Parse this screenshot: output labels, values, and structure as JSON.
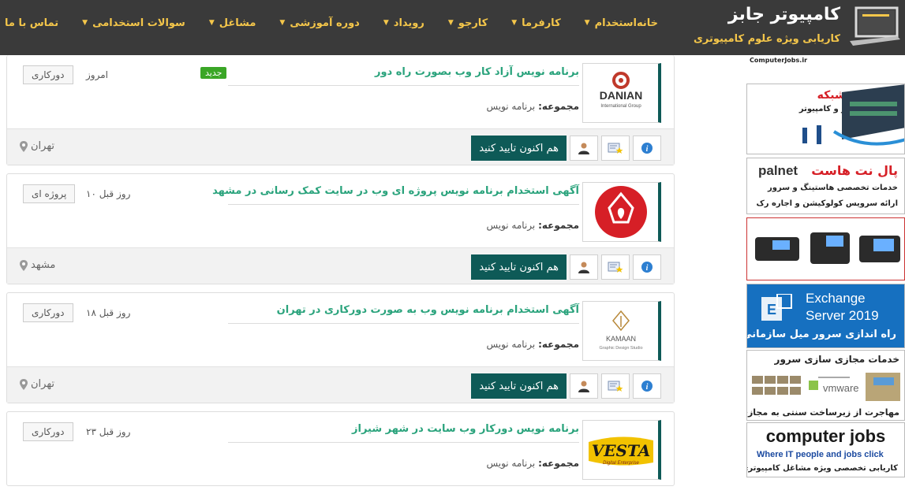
{
  "header": {
    "logo_title": "کامپیوتر جابز",
    "logo_subtitle": "کاریابی ویژه علوم کامپیوتری",
    "nav": [
      {
        "label": "خانه",
        "dropdown": false
      },
      {
        "label": "استخدام",
        "dropdown": true
      },
      {
        "label": "کارفرما",
        "dropdown": true
      },
      {
        "label": "کارجو",
        "dropdown": true
      },
      {
        "label": "رویداد",
        "dropdown": true
      },
      {
        "label": "دوره آموزشی",
        "dropdown": true
      },
      {
        "label": "مشاغل",
        "dropdown": true
      },
      {
        "label": "سوالات استخدامی",
        "dropdown": true
      },
      {
        "label": "تماس با ما",
        "dropdown": true
      }
    ]
  },
  "listings": [
    {
      "title": "برنامه نویس آزاد کار وب بصورت راه دور",
      "category_label": "مجموعه:",
      "category": "برنامه نویس",
      "badge": "جدید",
      "date": "امروز",
      "type": "دورکاری",
      "location": "تهران",
      "apply_label": "هم اکنون تایید کنید",
      "logo": "DANIAN",
      "logo_sub": "International Group"
    },
    {
      "title": "آگهی استخدام برنامه نویس پروژه ای وب در سایت کمک رسانی در مشهد",
      "category_label": "مجموعه:",
      "category": "برنامه نویس",
      "badge": "",
      "date": "۱۰ روز قبل",
      "type": "پروژه ای",
      "location": "مشهد",
      "apply_label": "هم اکنون تایید کنید",
      "logo": "",
      "logo_sub": ""
    },
    {
      "title": "آگهی استخدام برنامه نویس وب به صورت دورکاری در تهران",
      "category_label": "مجموعه:",
      "category": "برنامه نویس",
      "badge": "",
      "date": "۱۸ روز قبل",
      "type": "دورکاری",
      "location": "تهران",
      "apply_label": "هم اکنون تایید کنید",
      "logo": "KAMAAN",
      "logo_sub": "Graphic Design Studio"
    },
    {
      "title": "برنامه نویس دورکار وب سایت در شهر شیراز",
      "category_label": "مجموعه:",
      "category": "برنامه نویس",
      "badge": "",
      "date": "۲۳ روز قبل",
      "type": "دورکاری",
      "location": "",
      "apply_label": "هم اکنون تایید کنید",
      "logo": "VESTA",
      "logo_sub": "Digital Enterprise"
    }
  ],
  "ads": {
    "top_caption": "ComputerJobs.ir",
    "network": {
      "title": "پشتیبانی شبکه",
      "subtitle": "نگهداری سرور و کامپیوتر"
    },
    "palnet": {
      "brand": "palnet",
      "title": "پال نت هاست",
      "line1": "خدمات تخصصی هاستینگ و سرور",
      "line2": "ارائه سرویس کولوکیشن و اجاره رک"
    },
    "exchange": {
      "line1": "Exchange",
      "line2": "Server 2019",
      "line3": "راه اندازی سرور میل سازمانی"
    },
    "virtual": {
      "title": "خدمات مجازی سازی سرور",
      "brand": "vmware",
      "footer": "مهاجرت از زیرساخت سنتی به مجازی"
    },
    "cj": {
      "title": "computer jobs",
      "line1": "Where IT people and jobs click",
      "line2": "کاریابی تخصصی ویژه مشاغل کامپیوتری"
    }
  },
  "colors": {
    "topbar": "#3a3a3a",
    "nav_text": "#f4c64a",
    "title_green": "#2aa37c",
    "apply_bg": "#0e5a57",
    "badge_green": "#3aa626"
  }
}
